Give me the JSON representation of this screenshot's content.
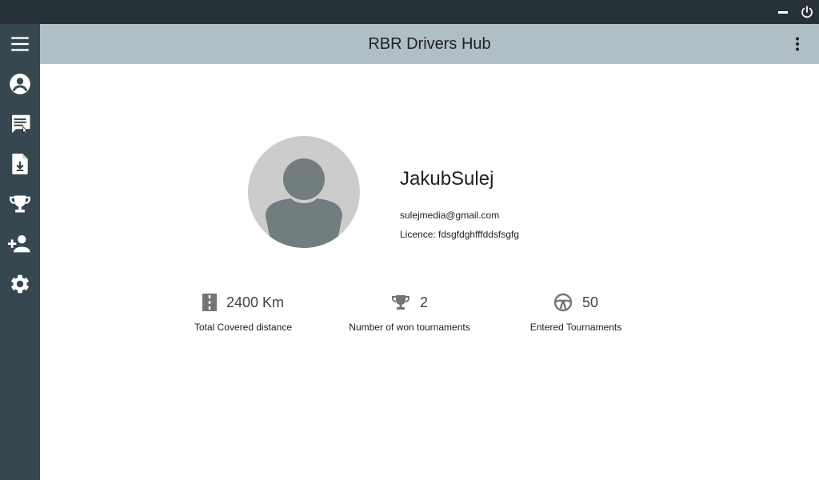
{
  "window": {
    "minimize_icon": "minimize-icon",
    "power_icon": "power-icon"
  },
  "sidebar": {
    "items": [
      {
        "name": "menu",
        "icon": "hamburger-menu-icon"
      },
      {
        "name": "profile",
        "icon": "account-circle-icon"
      },
      {
        "name": "messages",
        "icon": "message-text-icon"
      },
      {
        "name": "downloads",
        "icon": "file-download-icon"
      },
      {
        "name": "tournaments",
        "icon": "trophy-icon"
      },
      {
        "name": "add-user",
        "icon": "account-plus-icon"
      },
      {
        "name": "settings",
        "icon": "gear-icon"
      }
    ]
  },
  "appbar": {
    "title": "RBR Drivers Hub",
    "more_icon": "dots-vertical-icon"
  },
  "profile": {
    "username": "JakubSulej",
    "email": "sulejmedia@gmail.com",
    "licence": "Licence: fdsgfdghfffddsfsgfg"
  },
  "stats": [
    {
      "value": "2400 Km",
      "label": "Total Covered distance",
      "icon": "road-icon"
    },
    {
      "value": "2",
      "label": "Number of won tournaments",
      "icon": "trophy-icon"
    },
    {
      "value": "50",
      "label": "Entered Tournaments",
      "icon": "steering-wheel-icon"
    }
  ],
  "colors": {
    "titlebar": "#263238",
    "sidebar": "#37474f",
    "appbar": "#b0bec5",
    "avatar_bg": "#cccccc",
    "avatar_fg": "#727d80",
    "icon_gray": "#757575"
  }
}
